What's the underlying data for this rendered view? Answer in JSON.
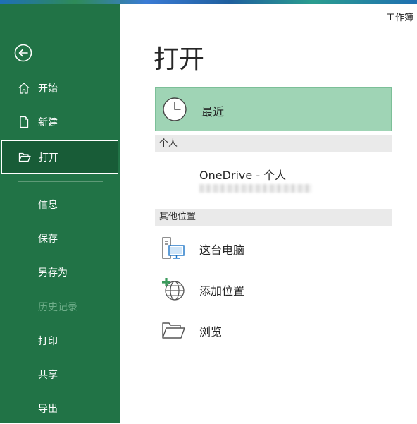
{
  "sidebar": {
    "items": [
      {
        "label": "开始"
      },
      {
        "label": "新建"
      },
      {
        "label": "打开"
      },
      {
        "label": "信息"
      },
      {
        "label": "保存"
      },
      {
        "label": "另存为"
      },
      {
        "label": "历史记录"
      },
      {
        "label": "打印"
      },
      {
        "label": "共享"
      },
      {
        "label": "导出"
      }
    ]
  },
  "header": {
    "doc_title": "工作簿"
  },
  "main": {
    "title": "打开",
    "recent_label": "最近",
    "personal_header": "个人",
    "onedrive_label": "OneDrive - 个人",
    "other_header": "其他位置",
    "locations": [
      {
        "label": "这台电脑",
        "icon": "computer-icon"
      },
      {
        "label": "添加位置",
        "icon": "add-place-icon"
      },
      {
        "label": "浏览",
        "icon": "folder-icon"
      }
    ]
  },
  "colors": {
    "accent": "#217346",
    "active": "#185c37",
    "recent_bg": "#9fd4b5"
  }
}
